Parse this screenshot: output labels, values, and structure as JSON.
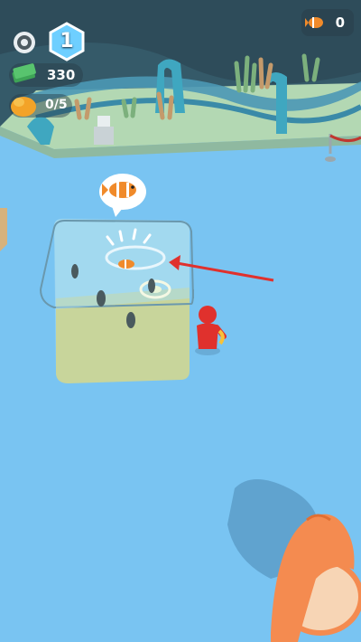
{
  "hud": {
    "level": "1",
    "cash": "330",
    "fish_capacity": "0/5",
    "fish_count": "0"
  },
  "icons": {
    "settings": "gear-icon",
    "level": "level-badge-icon",
    "cash": "cash-stack-icon",
    "capacity": "fish-bag-icon",
    "fish_counter": "clownfish-icon",
    "speech": "clownfish-speech-bubble-icon"
  },
  "colors": {
    "floor": "#79c4f2",
    "wall": "#2f4e5c",
    "tank_glass": "#bfe6f2",
    "tank_floor": "#c7d59a",
    "player": "#e0312d",
    "arrow": "#e0312d"
  }
}
